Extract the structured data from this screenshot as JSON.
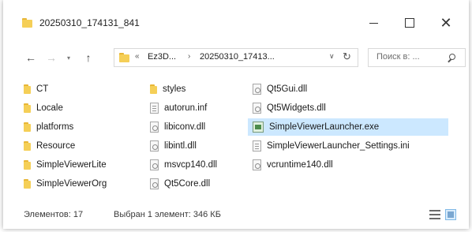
{
  "window": {
    "title": "20250310_174131_841",
    "controls": {
      "minimize": "minimize-icon",
      "maximize": "maximize-icon",
      "close": "close-icon"
    }
  },
  "nav": {
    "back_icon": "←",
    "forward_icon": "→",
    "recent_icon": "▾",
    "up_icon": "↑",
    "address": {
      "overflow": "«",
      "crumbs": [
        "Ez3D...",
        "20250310_17413..."
      ],
      "separator": "›",
      "dropdown_icon": "∨",
      "refresh_icon": "↻"
    },
    "search": {
      "placeholder": "Поиск в: ..."
    }
  },
  "files": {
    "column1": [
      {
        "name": "CT",
        "type": "folder"
      },
      {
        "name": "Locale",
        "type": "folder"
      },
      {
        "name": "platforms",
        "type": "folder"
      },
      {
        "name": "Resource",
        "type": "folder"
      },
      {
        "name": "SimpleViewerLite",
        "type": "folder"
      },
      {
        "name": "SimpleViewerOrg",
        "type": "folder"
      }
    ],
    "column2": [
      {
        "name": "styles",
        "type": "folder"
      },
      {
        "name": "autorun.inf",
        "type": "config"
      },
      {
        "name": "libiconv.dll",
        "type": "dll"
      },
      {
        "name": "libintl.dll",
        "type": "dll"
      },
      {
        "name": "msvcp140.dll",
        "type": "dll"
      },
      {
        "name": "Qt5Core.dll",
        "type": "dll"
      }
    ],
    "column3": [
      {
        "name": "Qt5Gui.dll",
        "type": "dll"
      },
      {
        "name": "Qt5Widgets.dll",
        "type": "dll"
      },
      {
        "name": "SimpleViewerLauncher.exe",
        "type": "exe",
        "selected": true
      },
      {
        "name": "SimpleViewerLauncher_Settings.ini",
        "type": "config"
      },
      {
        "name": "vcruntime140.dll",
        "type": "dll"
      }
    ]
  },
  "status": {
    "count": "Элементов: 17",
    "selected": "Выбран 1 элемент: 346 КБ"
  },
  "colors": {
    "selection": "#cce8ff",
    "folder": "#f5cf57"
  }
}
